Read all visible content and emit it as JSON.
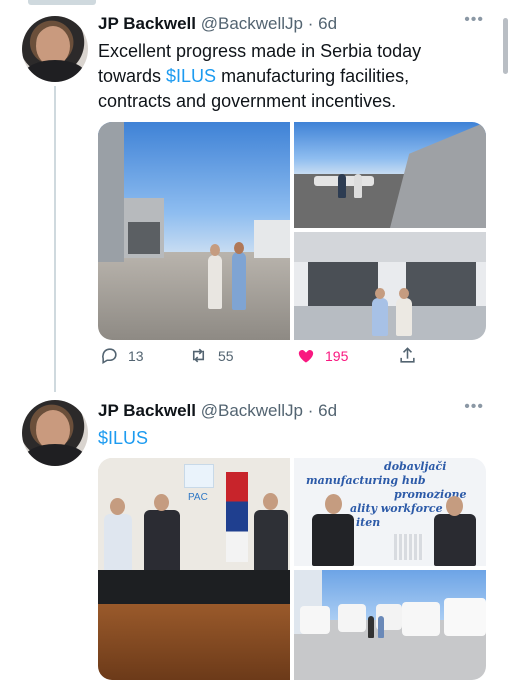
{
  "tweets": [
    {
      "author": "JP Backwell",
      "handle": "@BackwellJp",
      "time": "· 6d",
      "text_prefix": "Excellent progress made in Serbia today towards ",
      "cashtag": "$ILUS",
      "text_suffix": " manufacturing facilities, contracts and government incentives.",
      "actions": {
        "reply_count": "13",
        "retweet_count": "55",
        "like_count": "195"
      }
    },
    {
      "author": "JP Backwell",
      "handle": "@BackwellJp",
      "time": "· 6d",
      "cashtag": "$ILUS",
      "photo_texts": {
        "pac_logo": "PAC",
        "wall_sign_lines": [
          "dobavljači",
          "manufacturing hub",
          "promozione",
          "ality workforce",
          "iten"
        ]
      }
    }
  ],
  "icons": [
    "more-icon",
    "reply-icon",
    "retweet-icon",
    "like-icon",
    "share-icon"
  ],
  "colors": {
    "accent": "#1d9bf0",
    "like": "#f91880",
    "muted": "#536471",
    "thread_line": "#cfd9de"
  }
}
